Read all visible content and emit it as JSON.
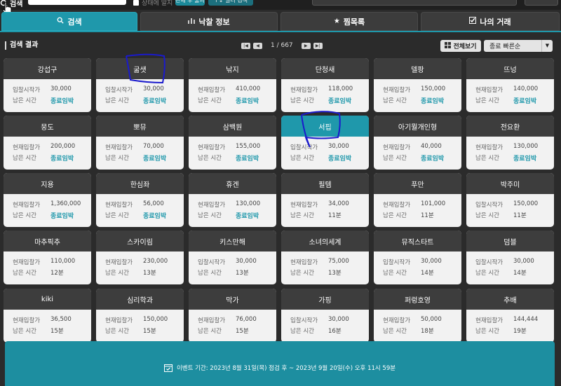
{
  "top": {
    "search_label": "검색",
    "check_label": "상태에 알지",
    "btn1_label": "판매 후 불과",
    "btn2_label": "↑↓ 필터 검색"
  },
  "tabs": [
    {
      "label": "검색",
      "icon": "search-icon",
      "active": true
    },
    {
      "label": "낙찰 정보",
      "icon": "bar-chart-icon",
      "active": false
    },
    {
      "label": "찜목록",
      "icon": "star-icon",
      "active": false
    },
    {
      "label": "나의 거래",
      "icon": "checkbox-icon",
      "active": false
    }
  ],
  "results": {
    "title": "검색 결과",
    "page_text": "1 / 667",
    "viewall_label": "전체보기",
    "sort_value": "종료 빠른순"
  },
  "items": [
    {
      "name": "강섭구",
      "price_label": "입찰시작가",
      "price": "30,000",
      "time_label": "남은 시간",
      "time": "종료임박",
      "hot": true
    },
    {
      "name": "굶샛",
      "price_label": "입찰시작가",
      "price": "30,000",
      "time_label": "남은 시간",
      "time": "종료임박",
      "hot": true
    },
    {
      "name": "낚지",
      "price_label": "현재입찰가",
      "price": "410,000",
      "time_label": "남은 시간",
      "time": "종료임박",
      "hot": true
    },
    {
      "name": "단청새",
      "price_label": "현재입찰가",
      "price": "118,000",
      "time_label": "남은 시간",
      "time": "종료임박",
      "hot": true
    },
    {
      "name": "델팡",
      "price_label": "현재입찰가",
      "price": "150,000",
      "time_label": "남은 시간",
      "time": "종료임박",
      "hot": true
    },
    {
      "name": "뜨넝",
      "price_label": "현재입찰가",
      "price": "140,000",
      "time_label": "남은 시간",
      "time": "종료임박",
      "hot": true
    },
    {
      "name": "뭉도",
      "price_label": "현재입찰가",
      "price": "200,000",
      "time_label": "남은 시간",
      "time": "종료임박",
      "hot": true
    },
    {
      "name": "뽀뮤",
      "price_label": "현재입찰가",
      "price": "70,000",
      "time_label": "남은 시간",
      "time": "종료임박",
      "hot": true
    },
    {
      "name": "삼백원",
      "price_label": "현재입찰가",
      "price": "155,000",
      "time_label": "남은 시간",
      "time": "종료임박",
      "hot": true
    },
    {
      "name": "서핍",
      "price_label": "입찰시작가",
      "price": "30,000",
      "time_label": "남은 시간",
      "time": "종료임박",
      "hot": true,
      "selected": true
    },
    {
      "name": "아기뭘개인형",
      "price_label": "현재입찰가",
      "price": "40,000",
      "time_label": "남은 시간",
      "time": "종료임박",
      "hot": true
    },
    {
      "name": "전요환",
      "price_label": "현재입찰가",
      "price": "130,000",
      "time_label": "남은 시간",
      "time": "종료임박",
      "hot": true
    },
    {
      "name": "지용",
      "price_label": "현재입찰가",
      "price": "1,360,000",
      "time_label": "남은 시간",
      "time": "종료임박",
      "hot": true
    },
    {
      "name": "한심좌",
      "price_label": "현재입찰가",
      "price": "56,000",
      "time_label": "남은 시간",
      "time": "종료임박",
      "hot": true
    },
    {
      "name": "휴겐",
      "price_label": "현재입찰가",
      "price": "130,000",
      "time_label": "남은 시간",
      "time": "종료임박",
      "hot": true
    },
    {
      "name": "필템",
      "price_label": "현재입찰가",
      "price": "34,000",
      "time_label": "남은 시간",
      "time": "11분",
      "hot": false
    },
    {
      "name": "푸만",
      "price_label": "현재입찰가",
      "price": "101,000",
      "time_label": "남은 시간",
      "time": "11분",
      "hot": false
    },
    {
      "name": "박주미",
      "price_label": "입찰시작가",
      "price": "150,000",
      "time_label": "남은 시간",
      "time": "11분",
      "hot": false
    },
    {
      "name": "마추픽추",
      "price_label": "현재입찰가",
      "price": "110,000",
      "time_label": "남은 시간",
      "time": "12분",
      "hot": false
    },
    {
      "name": "스카이림",
      "price_label": "현재입찰가",
      "price": "230,000",
      "time_label": "남은 시간",
      "time": "13분",
      "hot": false
    },
    {
      "name": "키스만해",
      "price_label": "입찰시작가",
      "price": "30,000",
      "time_label": "남은 시간",
      "time": "13분",
      "hot": false
    },
    {
      "name": "소녀의세계",
      "price_label": "현재입찰가",
      "price": "75,000",
      "time_label": "남은 시간",
      "time": "13분",
      "hot": false
    },
    {
      "name": "뮤직스타트",
      "price_label": "입찰시작가",
      "price": "30,000",
      "time_label": "남은 시간",
      "time": "14분",
      "hot": false
    },
    {
      "name": "덤블",
      "price_label": "입찰시작가",
      "price": "30,000",
      "time_label": "남은 시간",
      "time": "14분",
      "hot": false
    },
    {
      "name": "kiki",
      "price_label": "현재입찰가",
      "price": "36,500",
      "time_label": "남은 시간",
      "time": "15분",
      "hot": false
    },
    {
      "name": "심리학과",
      "price_label": "현재입찰가",
      "price": "150,000",
      "time_label": "남은 시간",
      "time": "15분",
      "hot": false
    },
    {
      "name": "막가",
      "price_label": "현재입찰가",
      "price": "76,000",
      "time_label": "남은 시간",
      "time": "15분",
      "hot": false
    },
    {
      "name": "가핑",
      "price_label": "입찰시작가",
      "price": "30,000",
      "time_label": "남은 시간",
      "time": "16분",
      "hot": false
    },
    {
      "name": "퍼렁호영",
      "price_label": "현재입찰가",
      "price": "50,000",
      "time_label": "남은 시간",
      "time": "18분",
      "hot": false
    },
    {
      "name": "추배",
      "price_label": "현재입찰가",
      "price": "144,444",
      "time_label": "남은 시간",
      "time": "19분",
      "hot": false
    }
  ],
  "event": {
    "icon": "calendar-check-icon",
    "text": "이벤트 기간: 2023년 8월 31일(목) 점검 후 ~ 2023년 9월 20일(수) 오후 11시 59분"
  },
  "colors": {
    "accent": "#1f98ab",
    "card_head": "#3d3d3d",
    "card_body": "#f2f2f2",
    "background": "#2b2b2b",
    "scribble": "#1a1acc"
  }
}
